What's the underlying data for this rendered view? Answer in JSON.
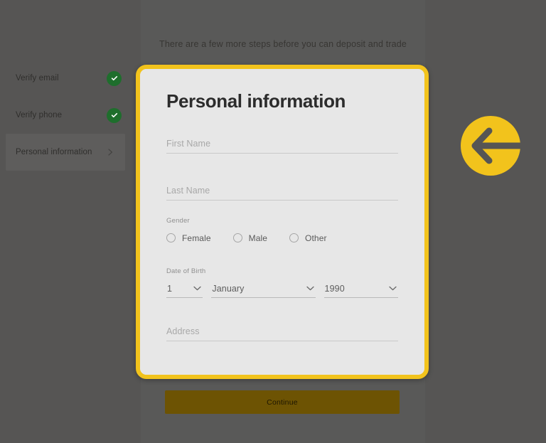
{
  "theme": {
    "overlay_bg": "#565554",
    "accent_yellow": "#f2c31c",
    "card_bg": "#e7e7e7",
    "success_green": "#1e6e2c",
    "button_bg": "#6d5303"
  },
  "headline": "There are a few more steps before you can deposit and trade",
  "sidebar": {
    "items": [
      {
        "label": "Verify email",
        "state": "complete",
        "icon": "check-circle-icon"
      },
      {
        "label": "Verify phone",
        "state": "complete",
        "icon": "check-circle-icon"
      },
      {
        "label": "Personal information",
        "state": "active",
        "icon": "chevron-right-icon"
      }
    ]
  },
  "card": {
    "title": "Personal information",
    "fields": {
      "first_name": {
        "label": "First Name",
        "placeholder": "First Name",
        "value": ""
      },
      "last_name": {
        "label": "Last Name",
        "placeholder": "Last Name",
        "value": ""
      },
      "address": {
        "label": "Address",
        "placeholder": "Address",
        "value": ""
      }
    },
    "gender": {
      "label": "Gender",
      "selected": "",
      "options": [
        {
          "label": "Female",
          "checked": false
        },
        {
          "label": "Male",
          "checked": false
        },
        {
          "label": "Other",
          "checked": false
        }
      ]
    },
    "date_of_birth": {
      "label": "Date of Birth",
      "day": "1",
      "month": "January",
      "year": "1990"
    }
  },
  "footer": {
    "continue_label": "Continue"
  },
  "annotation": {
    "icon": "arrow-left-icon",
    "color": "#f2c31c"
  }
}
